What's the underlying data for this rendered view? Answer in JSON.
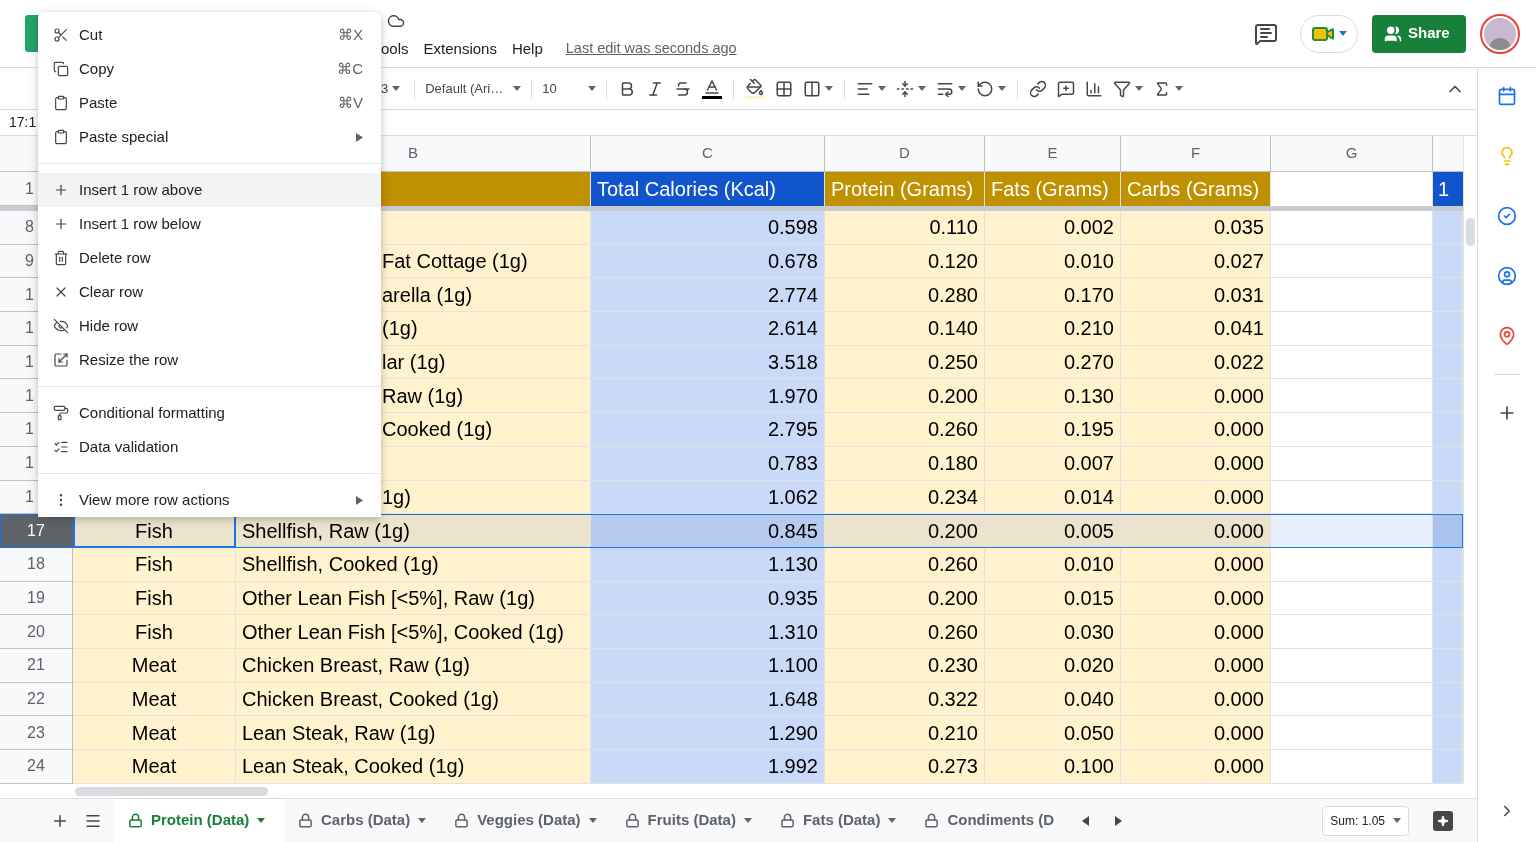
{
  "header": {
    "menu_bar": [
      "ools",
      "Extensions",
      "Help"
    ],
    "last_edit": "Last edit was seconds ago",
    "share": "Share"
  },
  "toolbar": {
    "format_partial": "3",
    "font": "Default (Ari…",
    "font_size": "10"
  },
  "name_box": "17:1",
  "column_headers": [
    "B",
    "C",
    "D",
    "E",
    "F",
    "G"
  ],
  "header_row": {
    "number": "1",
    "cells": [
      "Total Calories (Kcal)",
      "Protein (Grams)",
      "Fats (Grams)",
      "Carbs (Grams)"
    ],
    "overflow": "1"
  },
  "rows": [
    {
      "number": "8",
      "covered": true,
      "selected": false,
      "values": [
        "0.598",
        "0.110",
        "0.002",
        "0.035"
      ]
    },
    {
      "number": "9",
      "covered": true,
      "selected": false,
      "name": "Fat Cottage (1g)",
      "values": [
        "0.678",
        "0.120",
        "0.010",
        "0.027"
      ]
    },
    {
      "number": "1",
      "covered": true,
      "selected": false,
      "name": "arella (1g)",
      "values": [
        "2.774",
        "0.280",
        "0.170",
        "0.031"
      ]
    },
    {
      "number": "1",
      "covered": true,
      "selected": false,
      "name": "(1g)",
      "values": [
        "2.614",
        "0.140",
        "0.210",
        "0.041"
      ]
    },
    {
      "number": "1",
      "covered": true,
      "selected": false,
      "name": "lar (1g)",
      "values": [
        "3.518",
        "0.250",
        "0.270",
        "0.022"
      ]
    },
    {
      "number": "1",
      "covered": true,
      "selected": false,
      "name": "Raw (1g)",
      "values": [
        "1.970",
        "0.200",
        "0.130",
        "0.000"
      ]
    },
    {
      "number": "1",
      "covered": true,
      "selected": false,
      "name": "Cooked (1g)",
      "values": [
        "2.795",
        "0.260",
        "0.195",
        "0.000"
      ]
    },
    {
      "number": "1",
      "covered": true,
      "selected": false,
      "values": [
        "0.783",
        "0.180",
        "0.007",
        "0.000"
      ]
    },
    {
      "number": "1",
      "covered": true,
      "selected": false,
      "name": "1g)",
      "values": [
        "1.062",
        "0.234",
        "0.014",
        "0.000"
      ]
    },
    {
      "number": "17",
      "covered": false,
      "selected": true,
      "category": "Fish",
      "name": "Shellfish, Raw (1g)",
      "values": [
        "0.845",
        "0.200",
        "0.005",
        "0.000"
      ]
    },
    {
      "number": "18",
      "covered": false,
      "selected": false,
      "category": "Fish",
      "name": "Shellfish, Cooked (1g)",
      "values": [
        "1.130",
        "0.260",
        "0.010",
        "0.000"
      ]
    },
    {
      "number": "19",
      "covered": false,
      "selected": false,
      "category": "Fish",
      "name": "Other Lean Fish [<5%], Raw (1g)",
      "values": [
        "0.935",
        "0.200",
        "0.015",
        "0.000"
      ]
    },
    {
      "number": "20",
      "covered": false,
      "selected": false,
      "category": "Fish",
      "name": "Other Lean Fish [<5%], Cooked (1g)",
      "values": [
        "1.310",
        "0.260",
        "0.030",
        "0.000"
      ]
    },
    {
      "number": "21",
      "covered": false,
      "selected": false,
      "category": "Meat",
      "name": "Chicken Breast, Raw (1g)",
      "values": [
        "1.100",
        "0.230",
        "0.020",
        "0.000"
      ]
    },
    {
      "number": "22",
      "covered": false,
      "selected": false,
      "category": "Meat",
      "name": "Chicken Breast, Cooked (1g)",
      "values": [
        "1.648",
        "0.322",
        "0.040",
        "0.000"
      ]
    },
    {
      "number": "23",
      "covered": false,
      "selected": false,
      "category": "Meat",
      "name": "Lean Steak, Raw (1g)",
      "values": [
        "1.290",
        "0.210",
        "0.050",
        "0.000"
      ]
    },
    {
      "number": "24",
      "covered": false,
      "selected": false,
      "category": "Meat",
      "name": "Lean Steak, Cooked (1g)",
      "values": [
        "1.992",
        "0.273",
        "0.100",
        "0.000"
      ]
    }
  ],
  "sheet_tabs": [
    {
      "label": "Protein (Data)",
      "selected": true
    },
    {
      "label": "Carbs (Data)",
      "selected": false
    },
    {
      "label": "Veggies (Data)",
      "selected": false
    },
    {
      "label": "Fruits (Data)",
      "selected": false
    },
    {
      "label": "Fats (Data)",
      "selected": false
    },
    {
      "label": "Condiments (D",
      "selected": false
    }
  ],
  "sum": "Sum: 1.05",
  "context_menu": [
    [
      {
        "label": "Cut",
        "shortcut": "⌘X",
        "submenu": false,
        "selected": false
      },
      {
        "label": "Copy",
        "shortcut": "⌘C",
        "submenu": false,
        "selected": false
      },
      {
        "label": "Paste",
        "shortcut": "⌘V",
        "submenu": false,
        "selected": false
      },
      {
        "label": "Paste special",
        "submenu": true,
        "selected": false
      }
    ],
    [
      {
        "label": "Insert 1 row above",
        "submenu": false,
        "selected": true
      },
      {
        "label": "Insert 1 row below",
        "submenu": false,
        "selected": false
      },
      {
        "label": "Delete row",
        "submenu": false,
        "selected": false
      },
      {
        "label": "Clear row",
        "submenu": false,
        "selected": false
      },
      {
        "label": "Hide row",
        "submenu": false,
        "selected": false
      },
      {
        "label": "Resize the row",
        "submenu": false,
        "selected": false
      }
    ],
    [
      {
        "label": "Conditional formatting",
        "submenu": false,
        "selected": false
      },
      {
        "label": "Data validation",
        "submenu": false,
        "selected": false
      }
    ],
    [
      {
        "label": "View more row actions",
        "submenu": true,
        "selected": false
      }
    ]
  ]
}
